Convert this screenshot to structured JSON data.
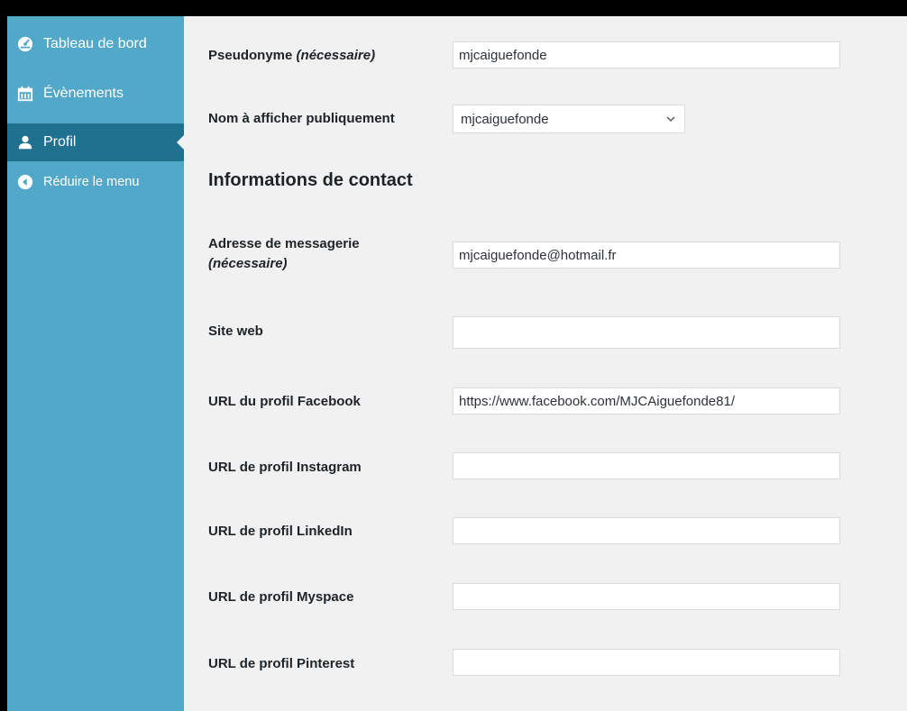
{
  "sidebar": {
    "items": [
      {
        "label": "Tableau de bord",
        "icon": "dashboard-icon"
      },
      {
        "label": "Évènements",
        "icon": "calendar-icon"
      },
      {
        "label": "Profil",
        "icon": "user-icon",
        "current": true
      },
      {
        "label": "Réduire le menu",
        "icon": "collapse-icon"
      }
    ]
  },
  "form": {
    "nickname": {
      "label": "Pseudonyme",
      "required": "(nécessaire)",
      "value": "mjcaiguefonde"
    },
    "display_name": {
      "label": "Nom à afficher publiquement",
      "value": "mjcaiguefonde"
    },
    "contact_section_title": "Informations de contact",
    "email": {
      "label": "Adresse de messagerie",
      "required": "(nécessaire)",
      "value": "mjcaiguefonde@hotmail.fr"
    },
    "website": {
      "label": "Site web",
      "value": ""
    },
    "facebook": {
      "label": "URL du profil Facebook",
      "value": "https://www.facebook.com/MJCAiguefonde81/"
    },
    "instagram": {
      "label": "URL de profil Instagram",
      "value": ""
    },
    "linkedin": {
      "label": "URL de profil LinkedIn",
      "value": ""
    },
    "myspace": {
      "label": "URL de profil Myspace",
      "value": ""
    },
    "pinterest": {
      "label": "URL de profil Pinterest",
      "value": ""
    }
  },
  "colors": {
    "sidebar_bg": "#52a8c9",
    "sidebar_current_bg": "#20708f",
    "content_bg": "#f1f1f1"
  }
}
